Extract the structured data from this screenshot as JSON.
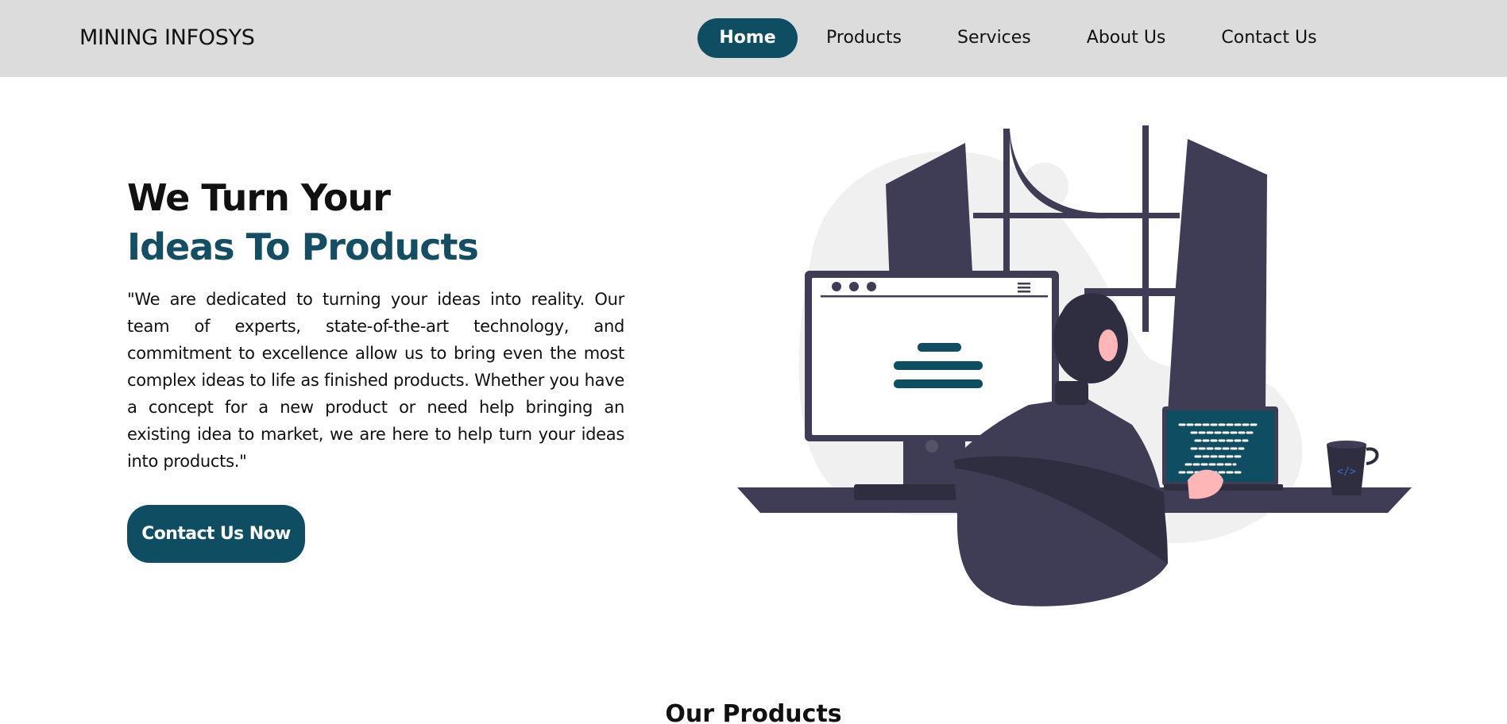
{
  "brand": "MINING INFOSYS",
  "nav": {
    "home": "Home",
    "products": "Products",
    "services": "Services",
    "about": "About Us",
    "contact": "Contact Us"
  },
  "hero": {
    "title_line1": "We Turn Your",
    "title_line2": "Ideas To Products",
    "description": "\"We are dedicated to turning your ideas into reality. Our team of experts, state-of-the-art technology, and commitment to excellence allow us to bring even the most complex ideas to life as finished products. Whether you have a concept for a new product or need help bringing an existing idea to market, we are here to help turn your ideas into products.\"",
    "cta_label": "Contact Us Now"
  },
  "products_section": {
    "title": "Our Products"
  },
  "colors": {
    "primary": "#0f4d63",
    "navbar_bg": "#dcdcdc",
    "illustration_dark": "#3f3d56",
    "illustration_skin": "#ffb6b6"
  }
}
